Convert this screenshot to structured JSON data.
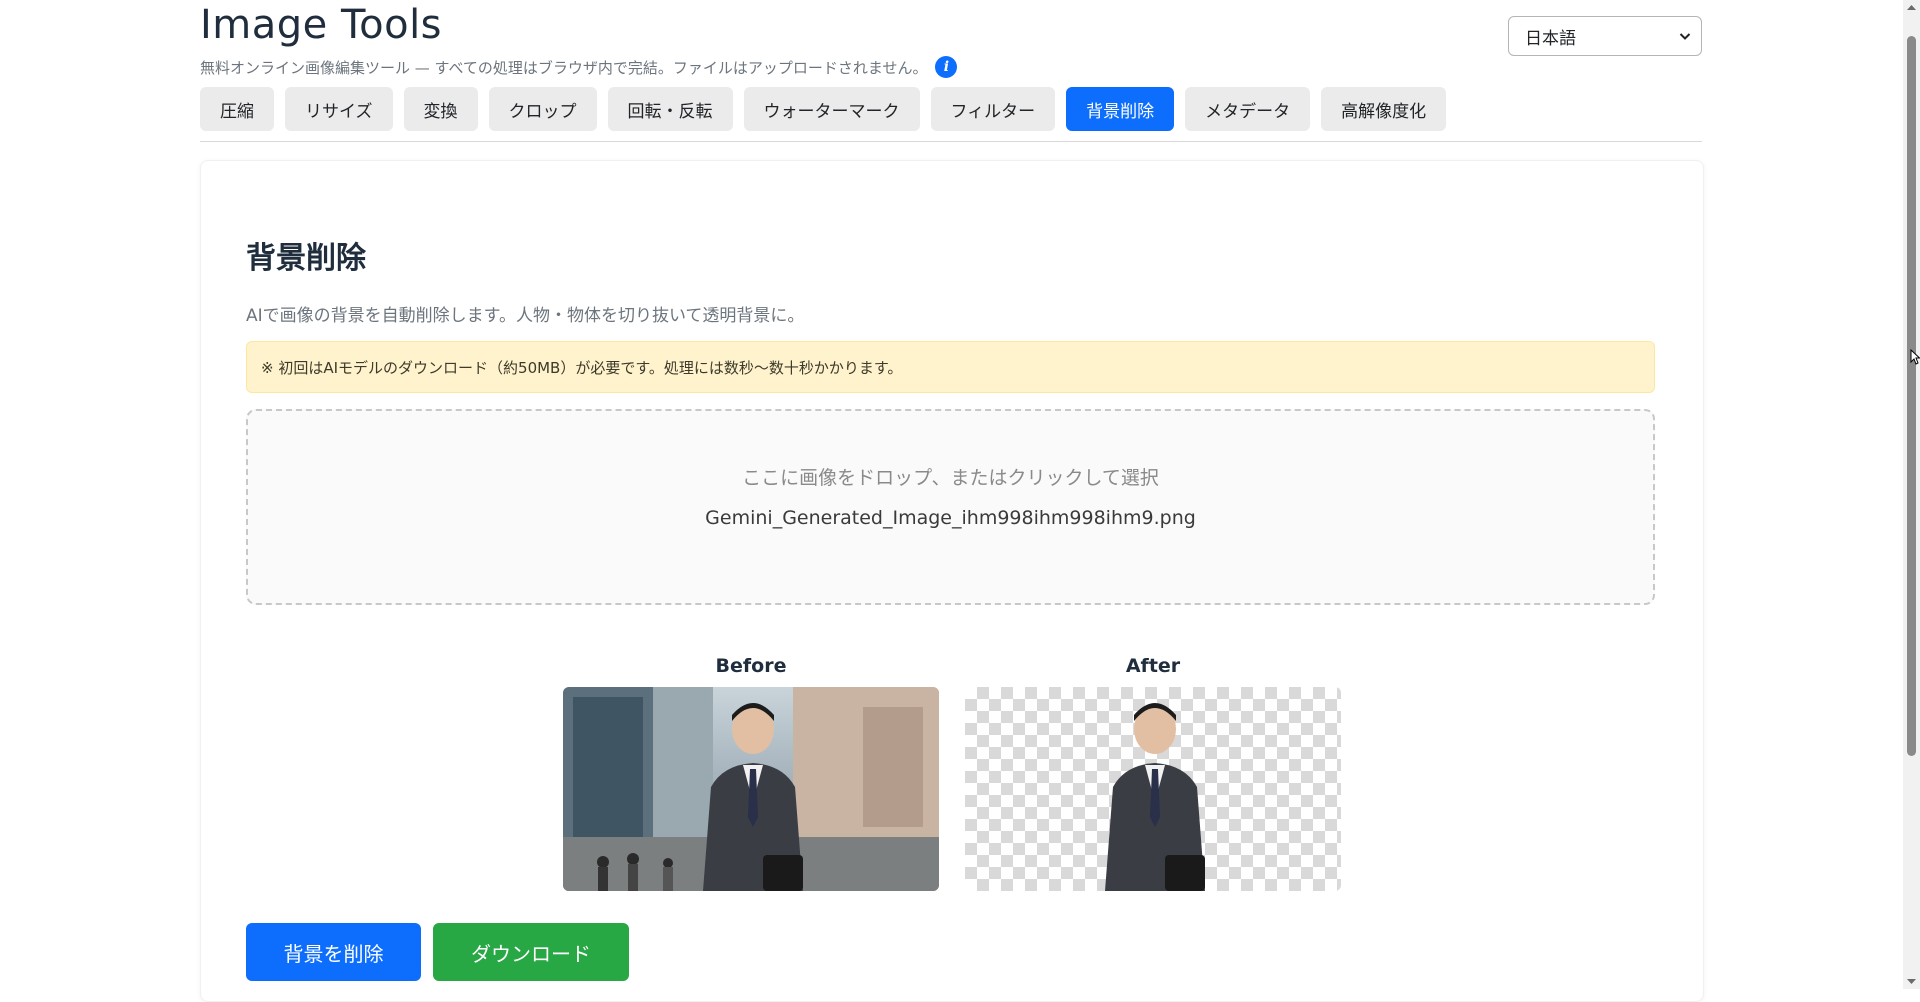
{
  "app": {
    "title": "Image Tools",
    "subtitle": "無料オンライン画像編集ツール — すべての処理はブラウザ内で完結。ファイルはアップロードされません。",
    "info_icon_glyph": "i"
  },
  "language_select": {
    "selected": "日本語"
  },
  "tabs": [
    {
      "label": "圧縮",
      "active": false
    },
    {
      "label": "リサイズ",
      "active": false
    },
    {
      "label": "変換",
      "active": false
    },
    {
      "label": "クロップ",
      "active": false
    },
    {
      "label": "回転・反転",
      "active": false
    },
    {
      "label": "ウォーターマーク",
      "active": false
    },
    {
      "label": "フィルター",
      "active": false
    },
    {
      "label": "背景削除",
      "active": true
    },
    {
      "label": "メタデータ",
      "active": false
    },
    {
      "label": "高解像度化",
      "active": false
    }
  ],
  "section": {
    "title": "背景削除",
    "description": "AIで画像の背景を自動削除します。人物・物体を切り抜いて透明背景に。",
    "notice": "※ 初回はAIモデルのダウンロード（約50MB）が必要です。処理には数秒〜数十秒かかります。"
  },
  "dropzone": {
    "prompt": "ここに画像をドロップ、またはクリックして選択",
    "filename": "Gemini_Generated_Image_ihm998ihm998ihm9.png"
  },
  "preview": {
    "before_label": "Before",
    "after_label": "After"
  },
  "buttons": {
    "remove_bg": "背景を削除",
    "download": "ダウンロード"
  },
  "colors": {
    "primary": "#0d6efd",
    "success": "#28a745",
    "notice_bg": "#fff3cd"
  }
}
